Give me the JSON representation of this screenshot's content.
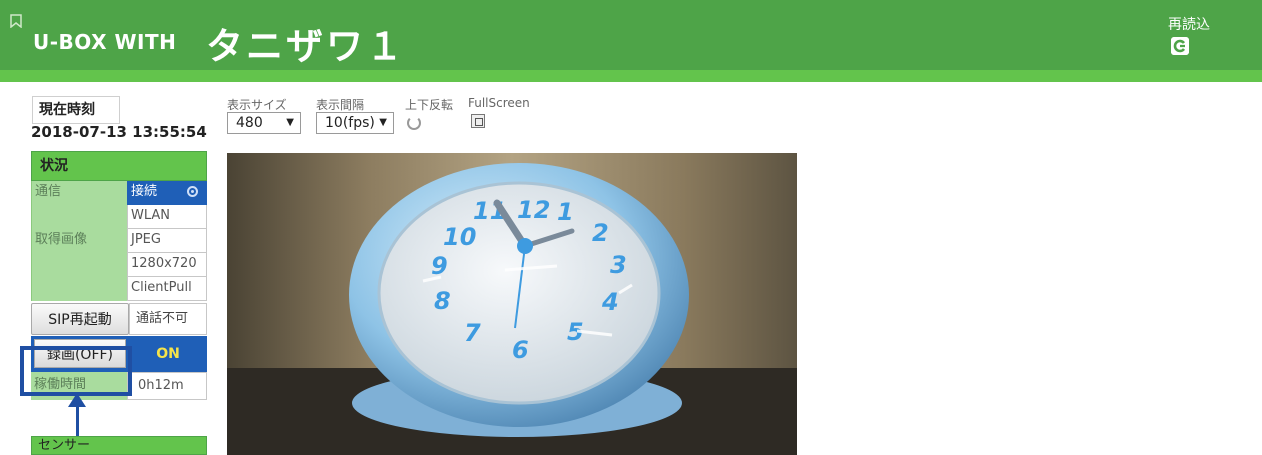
{
  "header": {
    "brand": "U-BOX WITH",
    "camera_name": "タニザワ１",
    "reload_label": "再読込",
    "colors": {
      "header_bg": "#4ea448",
      "header_strip": "#63c44c"
    }
  },
  "time": {
    "label": "現在時刻",
    "datetime": "2018-07-13 13:55:54"
  },
  "status": {
    "header": "状況",
    "rows": [
      {
        "label": "通信",
        "value": "接続"
      },
      {
        "label": "",
        "value": "WLAN"
      },
      {
        "label": "取得画像",
        "value": "JPEG"
      },
      {
        "label": "",
        "value": "1280x720"
      },
      {
        "label": "",
        "value": "ClientPull"
      }
    ],
    "sip_button": "SIP再起動",
    "sip_status": "通話不可",
    "record_button": "録画(OFF)",
    "record_state": "ON",
    "uptime_label": "稼働時間",
    "uptime_value": "0h12m",
    "colors": {
      "accent_blue": "#1f5fb7",
      "on_text": "#f5e34a"
    }
  },
  "sensor": {
    "header": "センサー"
  },
  "controls": {
    "display_size": {
      "label": "表示サイズ",
      "value": "480"
    },
    "display_interval": {
      "label": "表示間隔",
      "value": "10(fps)"
    },
    "flip": {
      "label": "上下反転"
    },
    "fullscreen": {
      "label": "FullScreen"
    }
  },
  "video": {
    "clock_numbers": [
      "12",
      "1",
      "2",
      "3",
      "4",
      "5",
      "6",
      "7",
      "8",
      "9",
      "10",
      "11"
    ]
  }
}
